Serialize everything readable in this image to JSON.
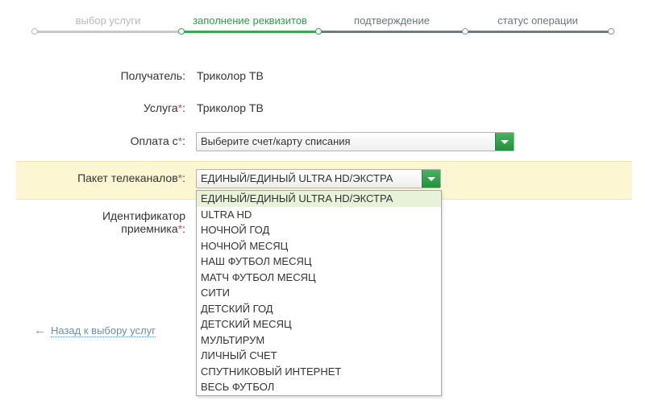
{
  "stepper": {
    "steps": [
      {
        "label": "выбор услуги",
        "state": "done"
      },
      {
        "label": "заполнение реквизитов",
        "state": "active"
      },
      {
        "label": "подтверждение",
        "state": "pending"
      },
      {
        "label": "статус операции",
        "state": "pending"
      }
    ]
  },
  "form": {
    "recipient": {
      "label": "Получатель:",
      "value": "Триколор ТВ"
    },
    "service": {
      "label": "Услуга",
      "required_mark": "*",
      "colon": ":",
      "value": "Триколор ТВ"
    },
    "payment_from": {
      "label": "Оплата с",
      "required_mark": "*",
      "colon": ":",
      "selected": "Выберите счет/карту списания"
    },
    "package": {
      "label": "Пакет телеканалов",
      "required_mark": "*",
      "colon": ":",
      "selected": "ЕДИНЫЙ/ЕДИНЫЙ ULTRA HD/ЭКСТРА",
      "options": [
        "ЕДИНЫЙ/ЕДИНЫЙ ULTRA HD/ЭКСТРА",
        "ULTRA HD",
        "НОЧНОЙ ГОД",
        "НОЧНОЙ МЕСЯЦ",
        "НАШ ФУТБОЛ МЕСЯЦ",
        "МАТЧ ФУТБОЛ МЕСЯЦ",
        "СИТИ",
        "ДЕТСКИЙ ГОД",
        "ДЕТСКИЙ МЕСЯЦ",
        "МУЛЬТИРУМ",
        "ЛИЧНЫЙ СЧЕТ",
        "СПУТНИКОВЫЙ ИНТЕРНЕТ",
        "ВЕСЬ ФУТБОЛ"
      ]
    },
    "receiver_id": {
      "label_line1": "Идентификатор",
      "label_line2": "приемника",
      "required_mark": "*",
      "colon": ":"
    }
  },
  "back_link": {
    "arrow": "←",
    "text": "Назад к выбору услуг"
  },
  "colors": {
    "accent_green": "#2e9d46",
    "highlight_row": "#fdf6d3",
    "link": "#6c8ea8",
    "required": "#d9534f"
  }
}
